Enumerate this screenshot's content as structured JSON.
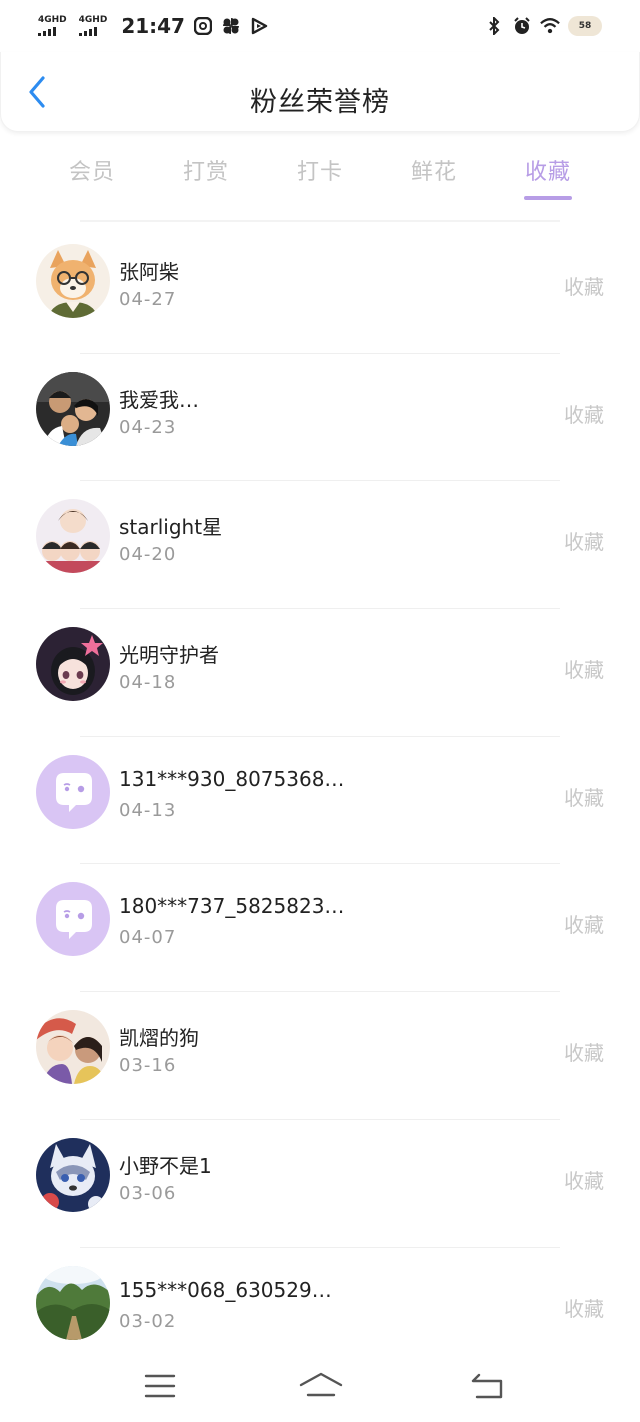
{
  "status_bar": {
    "network_1": "4GHD",
    "network_2": "4GHD",
    "time": "21:47",
    "battery": "58",
    "icons": [
      "chat-icon",
      "pinwheel-icon",
      "play-icon",
      "bluetooth-icon",
      "alarm-icon",
      "wifi-icon",
      "battery-icon"
    ]
  },
  "header": {
    "title": "粉丝荣誉榜",
    "back_icon": "chevron-left-icon"
  },
  "tabs": [
    {
      "label": "会员",
      "active": false
    },
    {
      "label": "打赏",
      "active": false
    },
    {
      "label": "打卡",
      "active": false
    },
    {
      "label": "鲜花",
      "active": false
    },
    {
      "label": "收藏",
      "active": true
    }
  ],
  "colors": {
    "accent": "#b79de6",
    "back_arrow": "#2d8cf0",
    "muted_text": "#c8c8c8"
  },
  "fans": [
    {
      "name": "张阿柴",
      "date": "04-27",
      "action": "收藏",
      "avatar": "shiba-dog-glasses"
    },
    {
      "name": "我爱我…",
      "date": "04-23",
      "action": "收藏",
      "avatar": "family-photo"
    },
    {
      "name": "starlight星",
      "date": "04-20",
      "action": "收藏",
      "avatar": "anime-group"
    },
    {
      "name": "光明守护者",
      "date": "04-18",
      "action": "收藏",
      "avatar": "anime-girl-star"
    },
    {
      "name": "131***930_8075368…",
      "date": "04-13",
      "action": "收藏",
      "avatar": "default-chat-bubble"
    },
    {
      "name": "180***737_5825823…",
      "date": "04-07",
      "action": "收藏",
      "avatar": "default-chat-bubble"
    },
    {
      "name": "凯熠的狗",
      "date": "03-16",
      "action": "收藏",
      "avatar": "anime-duo"
    },
    {
      "name": "小野不是1",
      "date": "03-06",
      "action": "收藏",
      "avatar": "husky-cartoon"
    },
    {
      "name": "155***068_630529…",
      "date": "03-02",
      "action": "收藏",
      "avatar": "forest-landscape"
    }
  ],
  "nav_bar": {
    "icons": [
      "menu-icon",
      "home-icon",
      "back-icon"
    ]
  }
}
